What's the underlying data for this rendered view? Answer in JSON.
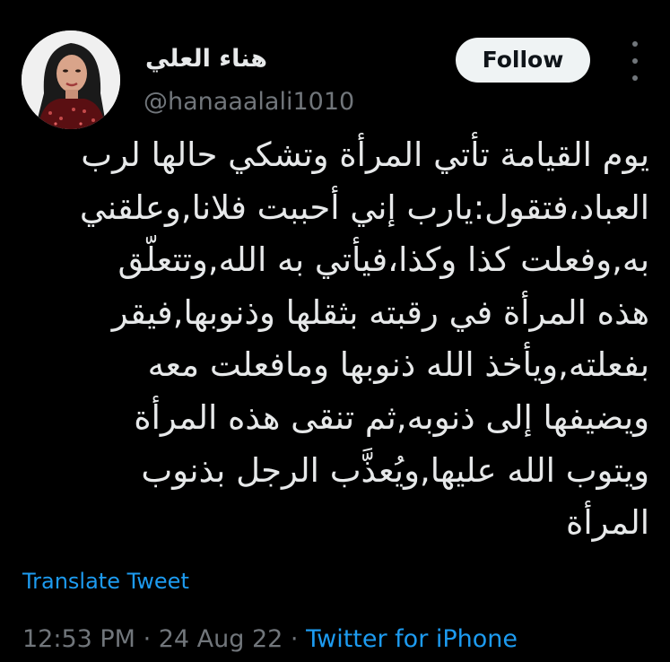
{
  "author": {
    "display_name": "هناء العلي",
    "handle": "@hanaaalali1010"
  },
  "follow_button": {
    "label": "Follow"
  },
  "more_menu": {
    "icon": "more-vertical-icon"
  },
  "tweet": {
    "lines": [
      "يوم القيامة تأتي المرأة وتشكي حالها لرب",
      "العباد،فتقول:يارب إني أحببت فلانا,وعلقني",
      "به,وفعلت كذا وكذا،فيأتي به الله,وتتعلّق",
      "هذه المرأة في رقبته بثقلها وذنوبها,فيقر",
      "بفعلته,ويأخذ الله ذنوبها ومافعلت معه",
      "ويضيفها إلى ذنوبه,ثم تنقى هذه المرأة",
      "ويتوب الله عليها,ويُعذَّب الرجل بذنوب",
      "المرأة"
    ],
    "translate_label": "Translate Tweet"
  },
  "meta": {
    "time": "12:53 PM",
    "separator_1": " · ",
    "date": "24 Aug 22",
    "separator_2": " · ",
    "source": "Twitter for iPhone"
  },
  "colors": {
    "background": "#000000",
    "text_primary": "#e7e9ea",
    "text_secondary": "#71767b",
    "link": "#1d9bf0",
    "follow_bg": "#eff3f4"
  }
}
